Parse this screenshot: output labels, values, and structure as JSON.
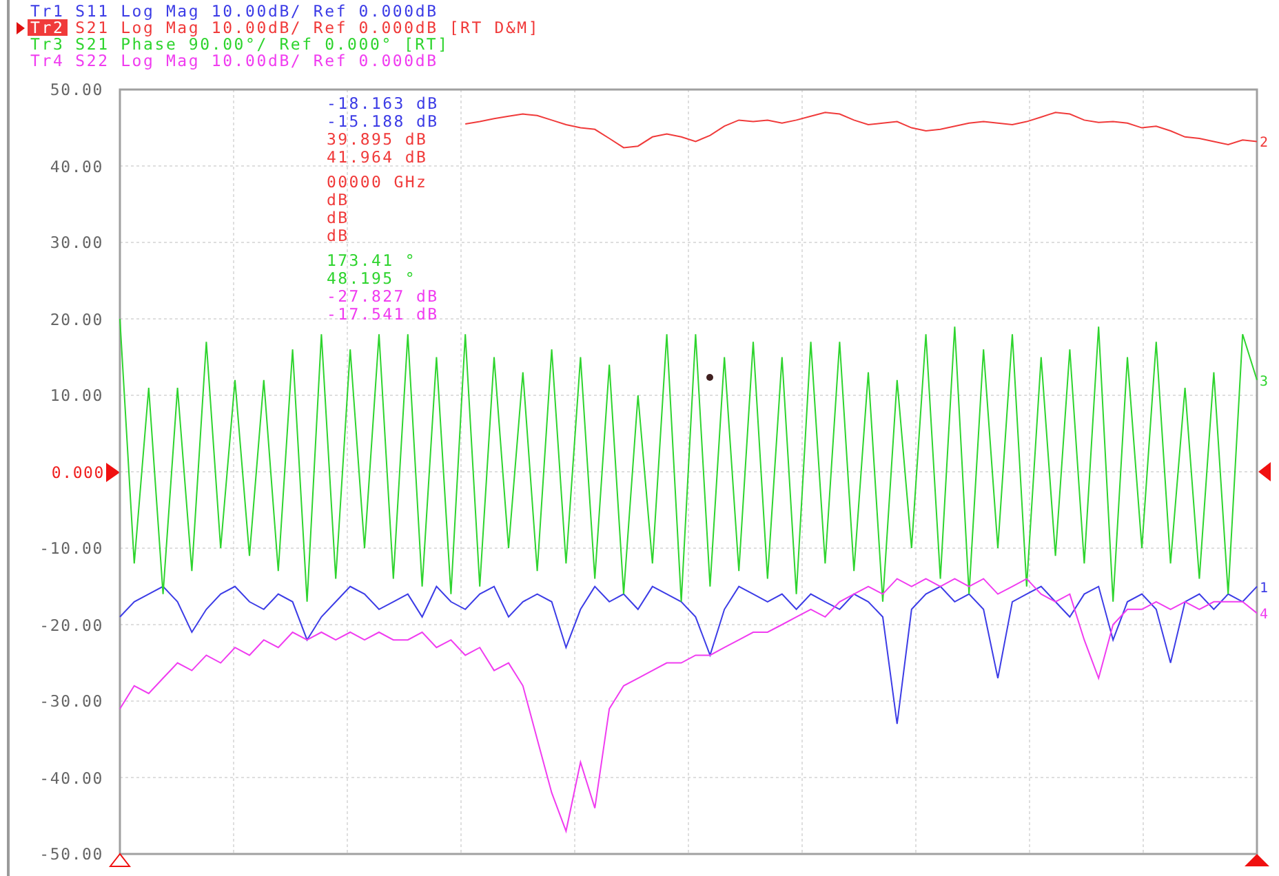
{
  "traces": [
    {
      "name": "Tr1",
      "settings": "S11 Log Mag 10.00dB/ Ref 0.000dB",
      "selected": false,
      "color": "#3c3ce6"
    },
    {
      "name": "Tr2",
      "settings": "S21 Log Mag 10.00dB/ Ref 0.000dB",
      "tag": "[RT D&M]",
      "selected": true,
      "color": "#f03a3a"
    },
    {
      "name": "Tr3",
      "settings": "S21 Phase 90.00°/ Ref 0.000°",
      "tag": "[RT]",
      "selected": false,
      "color": "#2ed42e"
    },
    {
      "name": "Tr4",
      "settings": "S22 Log Mag 10.00dB/ Ref 0.000dB",
      "selected": false,
      "color": "#f03cf0"
    }
  ],
  "plot": {
    "y_tick_marks": [
      {
        "reference": false
      },
      {
        "reference": false
      },
      {
        "reference": false
      },
      {
        "reference": false
      },
      {
        "reference": false
      },
      {
        "reference": true
      },
      {
        "reference": false
      },
      {
        "reference": false
      },
      {
        "reference": false
      },
      {
        "reference": false
      },
      {
        "reference": false
      }
    ],
    "chart_data": {
      "type": "line",
      "ylim": [
        -50,
        50
      ],
      "grid": true,
      "yticks": [
        {
          "value": 50,
          "label": "50.00"
        },
        {
          "value": 40,
          "label": "40.00"
        },
        {
          "value": 30,
          "label": "30.00"
        },
        {
          "value": 20,
          "label": "20.00"
        },
        {
          "value": 10,
          "label": "10.00"
        },
        {
          "value": 0,
          "label": "0.000"
        },
        {
          "value": -10,
          "label": "-10.00"
        },
        {
          "value": -20,
          "label": "-20.00"
        },
        {
          "value": -30,
          "label": "-30.00"
        },
        {
          "value": -40,
          "label": "-40.00"
        },
        {
          "value": -50,
          "label": "-50.00"
        }
      ],
      "series": [
        {
          "color": "#3c3ce6",
          "values": [
            -19,
            -17,
            -16,
            -15,
            -17,
            -21,
            -18,
            -16,
            -15,
            -17,
            -18,
            -16,
            -17,
            -22,
            -19,
            -17,
            -15,
            -16,
            -18,
            -17,
            -16,
            -19,
            -15,
            -17,
            -18,
            -16,
            -15,
            -19,
            -17,
            -16,
            -17,
            -23,
            -18,
            -15,
            -17,
            -16,
            -18,
            -15,
            -16,
            -17,
            -19,
            -24,
            -18,
            -15,
            -16,
            -17,
            -16,
            -18,
            -16,
            -17,
            -18,
            -16,
            -17,
            -19,
            -33,
            -18,
            -16,
            -15,
            -17,
            -16,
            -18,
            -27,
            -17,
            -16,
            -15,
            -17,
            -19,
            -16,
            -15,
            -22,
            -17,
            -16,
            -18,
            -25,
            -17,
            -16,
            -18,
            -16,
            -17,
            -15
          ]
        },
        {
          "color": "#f03a3a",
          "values": [
            null,
            null,
            null,
            null,
            null,
            null,
            null,
            null,
            null,
            null,
            null,
            null,
            null,
            null,
            null,
            null,
            null,
            null,
            null,
            null,
            null,
            null,
            null,
            null,
            45.5,
            45.8,
            46.2,
            46.5,
            46.8,
            46.6,
            46.0,
            45.4,
            45.0,
            44.8,
            43.6,
            42.4,
            42.6,
            43.8,
            44.2,
            43.8,
            43.2,
            44.0,
            45.2,
            46.0,
            45.8,
            46.0,
            45.6,
            46.0,
            46.5,
            47.0,
            46.8,
            46.0,
            45.4,
            45.6,
            45.8,
            45.0,
            44.6,
            44.8,
            45.2,
            45.6,
            45.8,
            45.6,
            45.4,
            45.8,
            46.4,
            47.0,
            46.8,
            46.0,
            45.7,
            45.8,
            45.6,
            45.0,
            45.2,
            44.6,
            43.8,
            43.6,
            43.2,
            42.8,
            43.4,
            43.2
          ]
        },
        {
          "color": "#2ed42e",
          "values": [
            20,
            -12,
            11,
            -16,
            11,
            -13,
            17,
            -10,
            12,
            -11,
            12,
            -13,
            16,
            -17,
            18,
            -14,
            16,
            -10,
            18,
            -14,
            18,
            -15,
            15,
            -16,
            18,
            -15,
            15,
            -10,
            13,
            -13,
            16,
            -12,
            15,
            -14,
            14,
            -16,
            10,
            -12,
            18,
            -17,
            18,
            -15,
            15,
            -13,
            17,
            -14,
            15,
            -16,
            17,
            -12,
            17,
            -13,
            13,
            -17,
            12,
            -10,
            18,
            -14,
            19,
            -16,
            16,
            -10,
            18,
            -15,
            15,
            -11,
            16,
            -12,
            19,
            -17,
            15,
            -10,
            17,
            -12,
            11,
            -14,
            13,
            -16,
            18,
            12
          ]
        },
        {
          "color": "#f03cf0",
          "values": [
            -31,
            -28,
            -29,
            -27,
            -25,
            -26,
            -24,
            -25,
            -23,
            -24,
            -22,
            -23,
            -21,
            -22,
            -21,
            -22,
            -21,
            -22,
            -21,
            -22,
            -22,
            -21,
            -23,
            -22,
            -24,
            -23,
            -26,
            -25,
            -28,
            -35,
            -42,
            -47,
            -38,
            -44,
            -31,
            -28,
            -27,
            -26,
            -25,
            -25,
            -24,
            -24,
            -23,
            -22,
            -21,
            -21,
            -20,
            -19,
            -18,
            -19,
            -17,
            -16,
            -15,
            -16,
            -14,
            -15,
            -14,
            -15,
            -14,
            -15,
            -14,
            -16,
            -15,
            -14,
            -16,
            -17,
            -16,
            -22,
            -27,
            -20,
            -18,
            -18,
            -17,
            -18,
            -17,
            -18,
            -17,
            -17,
            -17,
            -18.5
          ]
        }
      ]
    },
    "end_labels": [
      {
        "text": "2",
        "color": "#f03a3a"
      },
      {
        "text": "3",
        "color": "#2ed42e"
      },
      {
        "text": "1",
        "color": "#3c3ce6"
      },
      {
        "text": "4",
        "color": "#f03cf0"
      }
    ]
  },
  "readout_groups": [
    [
      {
        "text": "-18.163 dB",
        "color": "#3c3ce6"
      },
      {
        "text": "-15.188 dB",
        "color": "#3c3ce6"
      },
      {
        "text": "39.895 dB",
        "color": "#f03a3a"
      },
      {
        "text": "41.964 dB",
        "color": "#f03a3a"
      }
    ],
    [
      {
        "text": "00000 GHz",
        "color": "#f03a3a"
      },
      {
        "text": "dB",
        "color": "#f03a3a"
      },
      {
        "text": "dB",
        "color": "#f03a3a"
      },
      {
        "text": "dB",
        "color": "#f03a3a"
      }
    ],
    [
      {
        "text": "173.41 °",
        "color": "#2ed42e"
      },
      {
        "text": "48.195 °",
        "color": "#2ed42e"
      },
      {
        "text": "-27.827 dB",
        "color": "#f03cf0"
      },
      {
        "text": "-17.541 dB",
        "color": "#f03cf0"
      }
    ]
  ]
}
